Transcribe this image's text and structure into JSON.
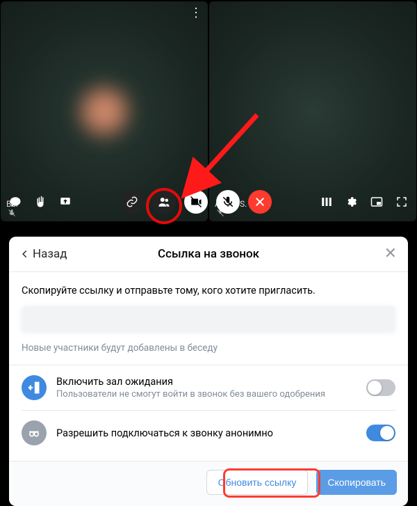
{
  "call": {
    "tiles": [
      {
        "label": "Вы"
      },
      {
        "label": "Artem S."
      }
    ]
  },
  "dialog": {
    "back": "Назад",
    "title": "Ссылка на звонок",
    "instruction": "Скопируйте ссылку и отправьте тому, кого хотите пригласить.",
    "hint": "Новые участники будут добавлены в беседу",
    "options": {
      "waiting": {
        "title": "Включить зал ожидания",
        "sub": "Пользователи не смогут войти в звонок без вашего одобрения"
      },
      "anon": {
        "title": "Разрешить подключаться к звонку анонимно"
      }
    },
    "buttons": {
      "refresh": "Обновить ссылку",
      "copy": "Скопировать"
    }
  }
}
